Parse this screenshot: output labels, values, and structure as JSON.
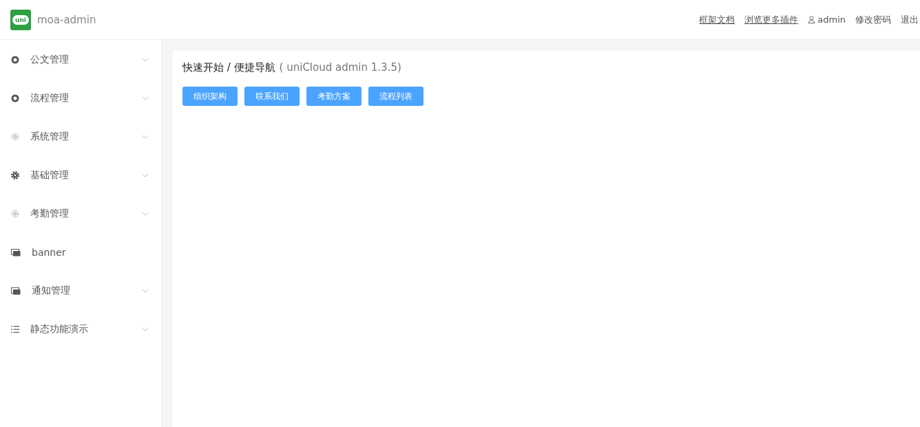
{
  "header": {
    "logo_text": "uni",
    "app_name": "moa-admin",
    "links": [
      {
        "label": "框架文档",
        "kind": "link"
      },
      {
        "label": "浏览更多插件",
        "kind": "link"
      },
      {
        "label": "admin",
        "kind": "user"
      },
      {
        "label": "修改密码",
        "kind": "plain"
      },
      {
        "label": "退出",
        "kind": "plain"
      }
    ]
  },
  "sidebar": {
    "items": [
      {
        "label": "公文管理",
        "kind": "dot",
        "expandable": true
      },
      {
        "label": "流程管理",
        "kind": "dot",
        "expandable": true
      },
      {
        "label": "系统管理",
        "kind": "gearoutline",
        "expandable": true
      },
      {
        "label": "基础管理",
        "kind": "gearsolid",
        "expandable": true
      },
      {
        "label": "考勤管理",
        "kind": "gearoutline",
        "expandable": true
      },
      {
        "label": "banner",
        "kind": "image",
        "expandable": false
      },
      {
        "label": "通知管理",
        "kind": "image",
        "expandable": true
      },
      {
        "label": "静态功能演示",
        "kind": "list",
        "expandable": true
      }
    ]
  },
  "panel": {
    "title": "快速开始 / 便捷导航",
    "subtitle": "( uniCloud admin 1.3.5)",
    "buttons": [
      "组织架构",
      "联系我们",
      "考勤方案",
      "流程列表"
    ]
  }
}
